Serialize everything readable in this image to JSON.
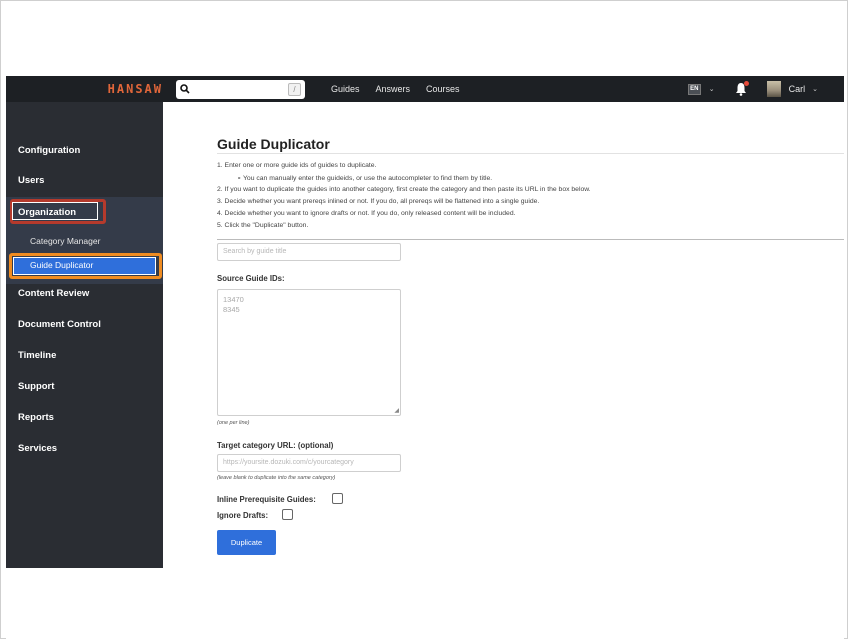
{
  "header": {
    "brand": "HANSAW",
    "search": {
      "placeholder": "",
      "shortcut": "/"
    },
    "nav_links": [
      "Guides",
      "Answers",
      "Courses"
    ],
    "language": "EN",
    "user_name": "Carl"
  },
  "sidebar": {
    "collapse_icon": "‹",
    "items": [
      "Configuration",
      "Users",
      "Organization",
      "Content Review",
      "Document Control",
      "Timeline",
      "Support",
      "Reports",
      "Services"
    ],
    "sub_items": [
      "Category Manager",
      "Guide Duplicator"
    ],
    "active_item": "Guide Duplicator"
  },
  "main": {
    "title": "Guide Duplicator",
    "instructions": [
      "1. Enter one or more guide ids of guides to duplicate.",
      "∘  You can manually enter the guideids, or use the autocompleter to find them by title.",
      "2. If you want to duplicate the guides into another category, first create the category and then paste its URL in the box below.",
      "3. Decide whether you want prereqs inlined or not. If you do, all prereqs will be flattened into a single guide.",
      "4. Decide whether you want to ignore drafts or not. If you do, only released content will be included.",
      "5. Click the \"Duplicate\" button."
    ],
    "search_placeholder": "Search by guide title",
    "source_label": "Source Guide IDs:",
    "source_ids": [
      "13470",
      "8345"
    ],
    "source_hint": "(one per line)",
    "target_label": "Target category URL: (optional)",
    "target_placeholder": "https://yoursite.dozuki.com/c/yourcategory",
    "target_hint": "(leave blank to duplicate into the same category)",
    "inline_label": "Inline Prerequisite Guides:",
    "inline_checked": false,
    "drafts_label": "Ignore Drafts:",
    "drafts_checked": false,
    "button_label": "Duplicate"
  },
  "colors": {
    "navbar": "#1d2024",
    "sidebar": "#2a2d33",
    "accent": "#2f6fdb",
    "highlight_red": "#b53a2c",
    "highlight_orange": "#f08c21",
    "brand": "#e0663a"
  }
}
